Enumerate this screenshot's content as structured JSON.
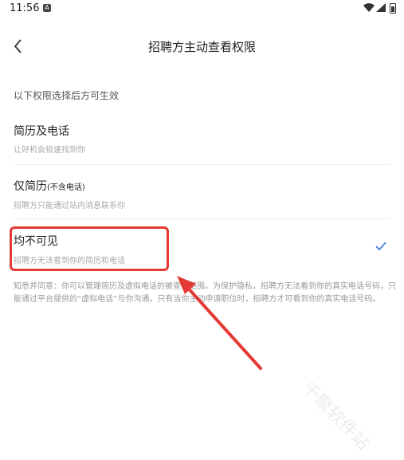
{
  "status_bar": {
    "time": "11:56",
    "notification_icon": "A"
  },
  "header": {
    "title": "招聘方主动查看权限",
    "back_icon": "chevron-left-icon"
  },
  "section_hint": "以下权限选择后方可生效",
  "options": [
    {
      "label": "简历及电话",
      "label_suffix": "",
      "desc": "让好机会极速找到你",
      "selected": false
    },
    {
      "label": "仅简历",
      "label_suffix": "(不含电话)",
      "desc": "招聘方只能通过站内消息联系你",
      "selected": false
    },
    {
      "label": "均不可见",
      "label_suffix": "",
      "desc": "招聘方无法看到你的简历和电话",
      "selected": true
    }
  ],
  "note": "知悉并同意：你可以管理简历及虚拟电话的被查看范围。为保护隐私，招聘方无法看到你的真实电话号码，只能通过平台提供的“虚拟电话”与你沟通。只有当你主动申请职位时，招聘方才可看到你的真实电话号码。",
  "watermark": "千聚软件站",
  "colors": {
    "accent": "#2f6fe0",
    "annotation": "#e53935"
  }
}
